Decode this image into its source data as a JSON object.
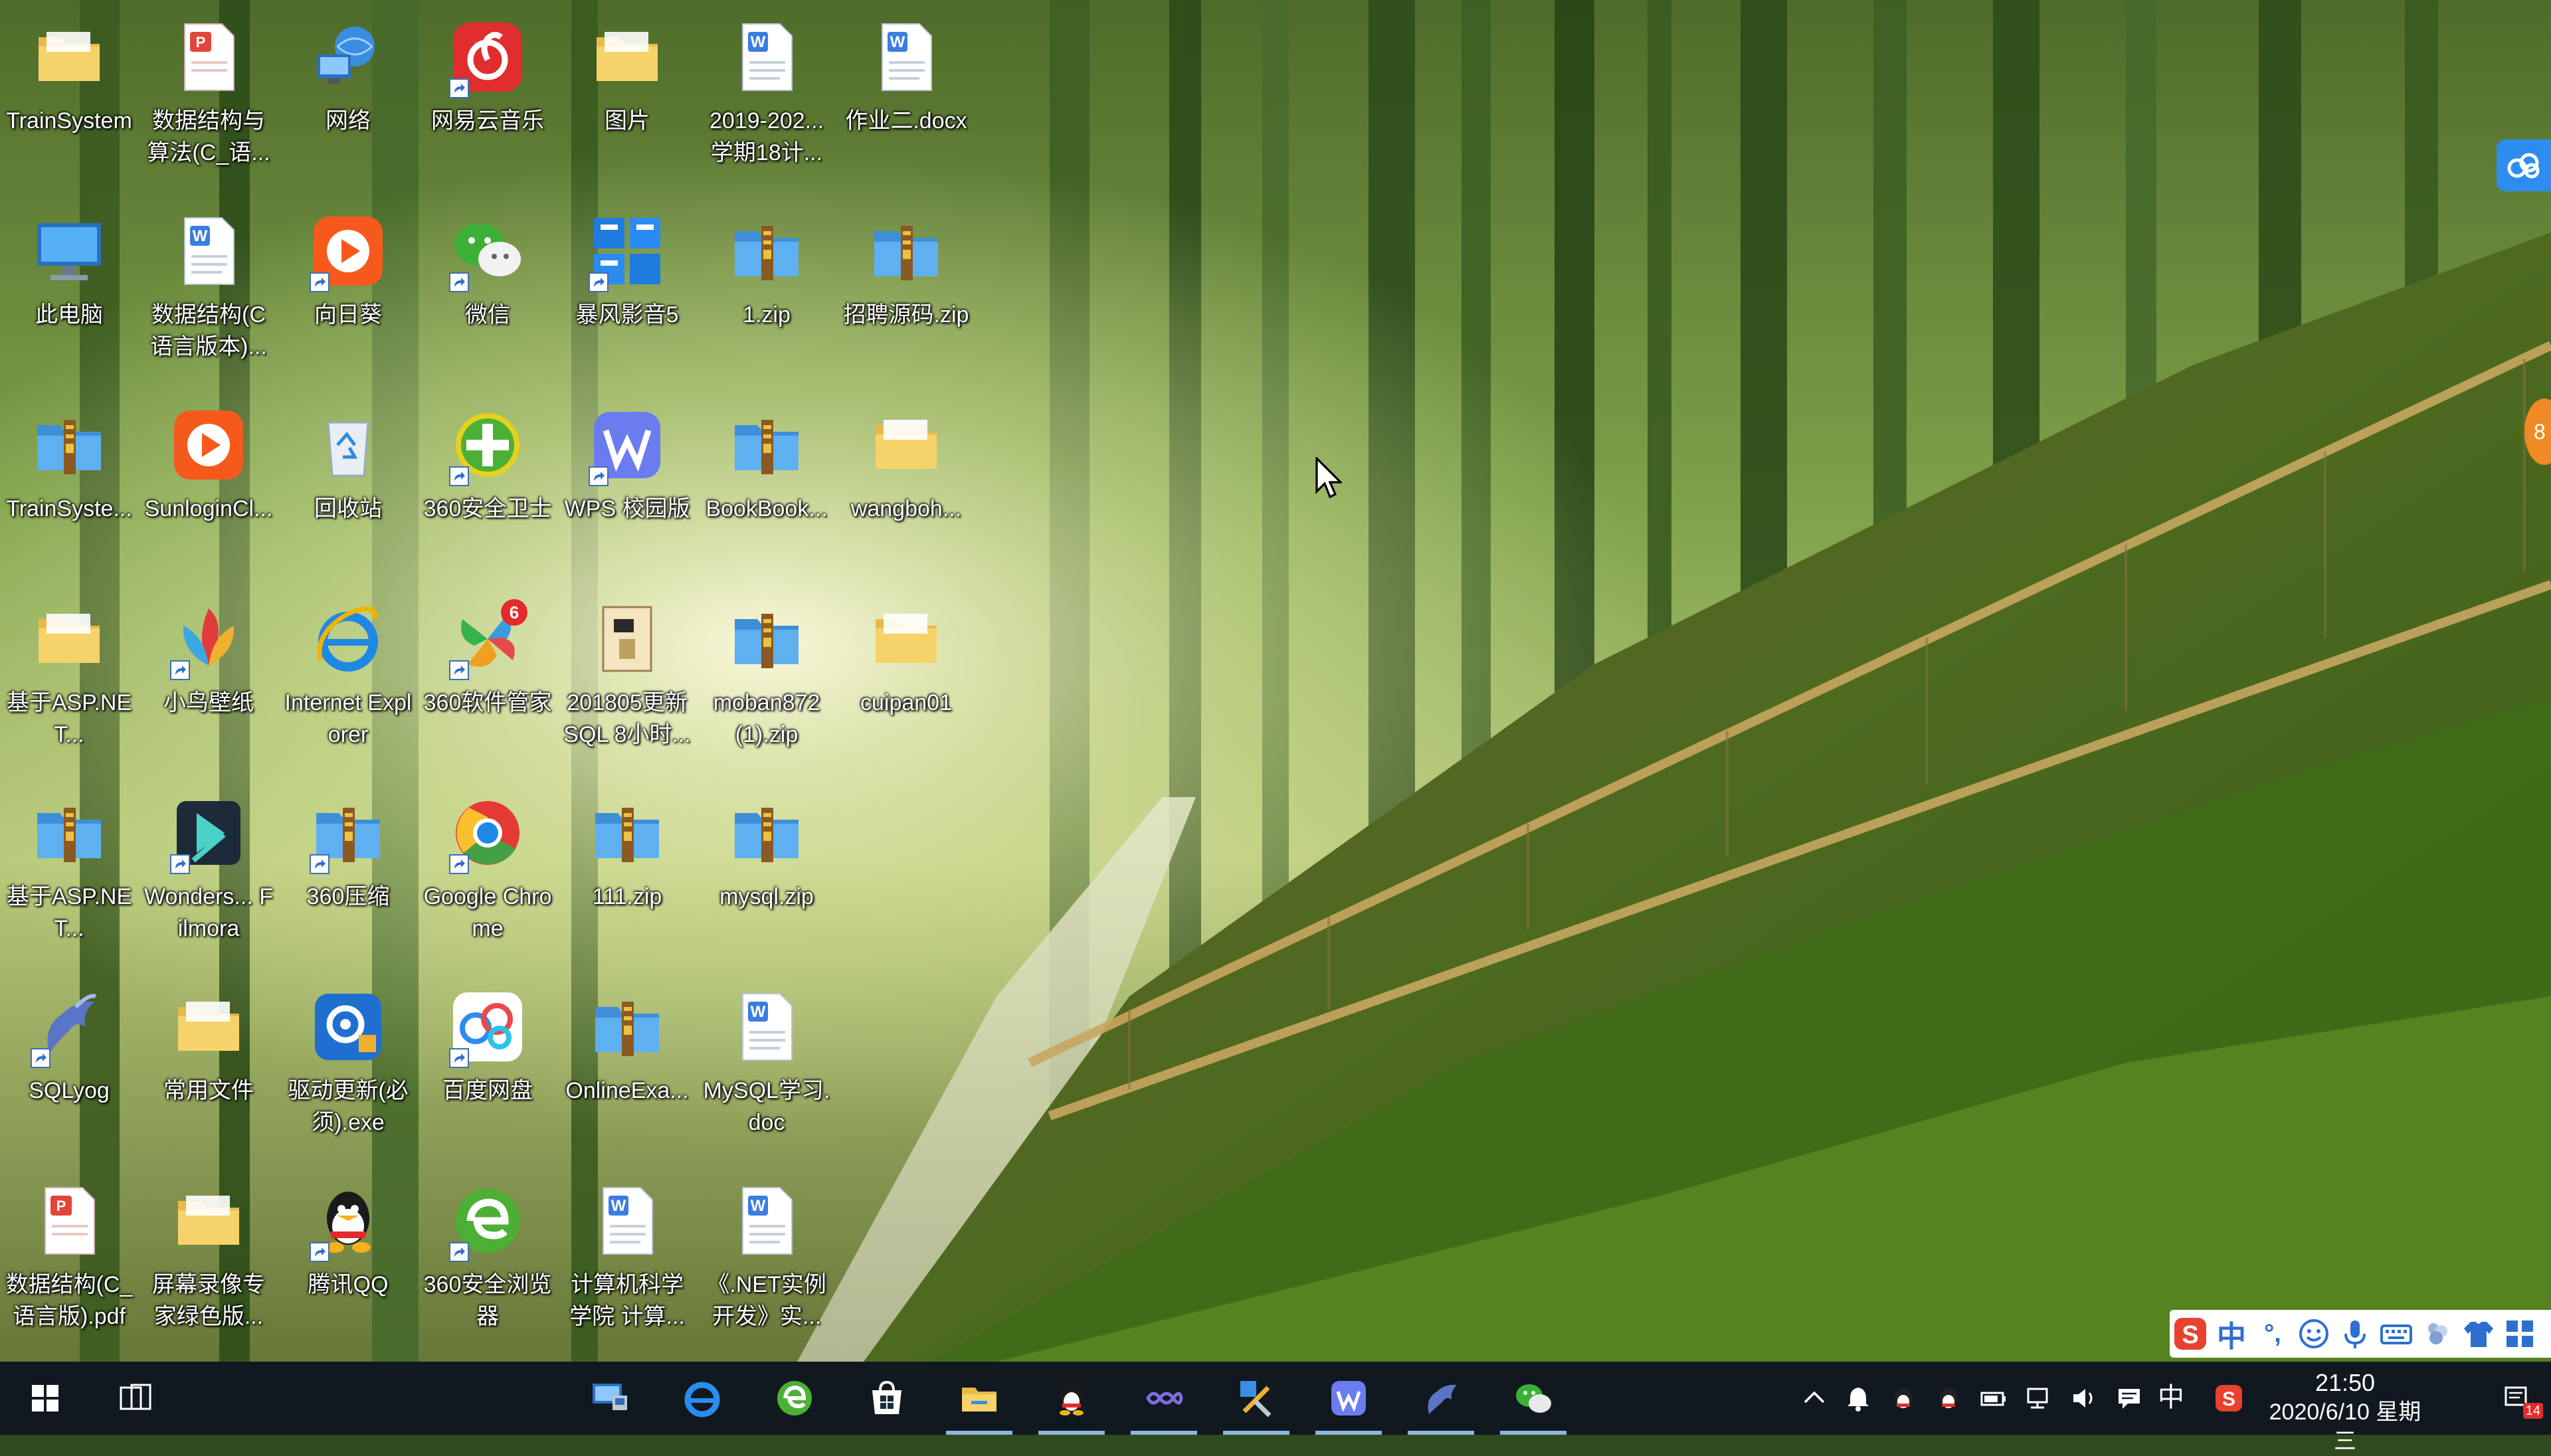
{
  "desktop": {
    "icons": [
      {
        "label": "TrainSystem",
        "icon": "folder-icon",
        "shortcut": false
      },
      {
        "label": "数据结构与算法(C_语...",
        "icon": "pdf-icon",
        "shortcut": false
      },
      {
        "label": "网络",
        "icon": "network-icon",
        "shortcut": false
      },
      {
        "label": "网易云音乐",
        "icon": "netease-music-icon",
        "shortcut": true
      },
      {
        "label": "图片",
        "icon": "folder-icon",
        "shortcut": false
      },
      {
        "label": "2019-202...学期18计...",
        "icon": "wps-doc-icon",
        "shortcut": false
      },
      {
        "label": "作业二.docx",
        "icon": "wps-doc-icon",
        "shortcut": false
      },
      {
        "label": "此电脑",
        "icon": "computer-icon",
        "shortcut": false
      },
      {
        "label": "数据结构(C语言版本)...",
        "icon": "wps-doc-icon",
        "shortcut": false
      },
      {
        "label": "向日葵",
        "icon": "sunlogin-icon",
        "shortcut": true
      },
      {
        "label": "微信",
        "icon": "wechat-icon",
        "shortcut": true
      },
      {
        "label": "暴风影音5",
        "icon": "baofeng-icon",
        "shortcut": true
      },
      {
        "label": "1.zip",
        "icon": "zip-icon",
        "shortcut": false
      },
      {
        "label": "招聘源码.zip",
        "icon": "zip-icon",
        "shortcut": false
      },
      {
        "label": "TrainSyste...",
        "icon": "zip-icon",
        "shortcut": false
      },
      {
        "label": "SunloginCl...",
        "icon": "sunlogin-icon",
        "shortcut": false
      },
      {
        "label": "回收站",
        "icon": "recycle-bin-icon",
        "shortcut": false
      },
      {
        "label": "360安全卫士",
        "icon": "360-security-icon",
        "shortcut": true
      },
      {
        "label": "WPS 校园版",
        "icon": "wps-icon",
        "shortcut": true
      },
      {
        "label": "BookBook...",
        "icon": "zip-icon",
        "shortcut": false
      },
      {
        "label": "wangboh...",
        "icon": "folder-icon",
        "shortcut": false
      },
      {
        "label": "基于ASP.NET...",
        "icon": "folder-icon",
        "shortcut": false
      },
      {
        "label": "小鸟壁纸",
        "icon": "bird-wallpaper-icon",
        "shortcut": true
      },
      {
        "label": "Internet Explorer",
        "icon": "ie-icon",
        "shortcut": false
      },
      {
        "label": "360软件管家",
        "icon": "360-software-icon",
        "shortcut": true,
        "badge": "6"
      },
      {
        "label": "201805更新SQL 8小时...",
        "icon": "archive-icon",
        "shortcut": false
      },
      {
        "label": "moban872(1).zip",
        "icon": "zip-icon",
        "shortcut": false
      },
      {
        "label": "cuipan01",
        "icon": "folder-icon",
        "shortcut": false
      },
      {
        "label": "基于ASP.NET...",
        "icon": "zip-icon",
        "shortcut": false
      },
      {
        "label": "Wonders... Filmora",
        "icon": "filmora-icon",
        "shortcut": true
      },
      {
        "label": "360压缩",
        "icon": "zip-icon",
        "shortcut": true
      },
      {
        "label": "Google Chrome",
        "icon": "chrome-icon",
        "shortcut": true
      },
      {
        "label": "111.zip",
        "icon": "zip-icon",
        "shortcut": false
      },
      {
        "label": "mysql.zip",
        "icon": "zip-icon",
        "shortcut": false
      },
      {
        "label": "SQLyog",
        "icon": "sqlyog-icon",
        "shortcut": true
      },
      {
        "label": "常用文件",
        "icon": "folder-icon",
        "shortcut": false
      },
      {
        "label": "驱动更新(必须).exe",
        "icon": "driver-update-icon",
        "shortcut": false
      },
      {
        "label": "百度网盘",
        "icon": "baidu-netdisk-icon",
        "shortcut": true
      },
      {
        "label": "OnlineExa...",
        "icon": "zip-icon",
        "shortcut": false
      },
      {
        "label": "MySQL学习.doc",
        "icon": "wps-doc-icon",
        "shortcut": false
      },
      {
        "label": "数据结构(C_语言版).pdf",
        "icon": "pdf-icon",
        "shortcut": false
      },
      {
        "label": "屏幕录像专家绿色版...",
        "icon": "folder-icon",
        "shortcut": false
      },
      {
        "label": "腾讯QQ",
        "icon": "qq-icon",
        "shortcut": true
      },
      {
        "label": "360安全浏览器",
        "icon": "360-browser-icon",
        "shortcut": true
      },
      {
        "label": "计算机科学学院 计算...",
        "icon": "wps-doc-icon",
        "shortcut": false
      },
      {
        "label": "《.NET实例开发》实...",
        "icon": "wps-doc-icon",
        "shortcut": false
      }
    ]
  },
  "taskbar": {
    "start_icon": "windows-start-icon",
    "task_view_icon": "task-view-icon",
    "pinned": [
      {
        "name": "remote-desktop-icon",
        "running": false
      },
      {
        "name": "edge-icon",
        "running": false
      },
      {
        "name": "360-browser-icon",
        "running": false
      },
      {
        "name": "store-icon",
        "running": false
      },
      {
        "name": "file-explorer-icon",
        "running": true
      },
      {
        "name": "qq-icon",
        "running": true
      },
      {
        "name": "vs-icon",
        "running": true
      },
      {
        "name": "tools-icon",
        "running": true
      },
      {
        "name": "wps-icon",
        "running": true
      },
      {
        "name": "sqlyog-icon",
        "running": true
      },
      {
        "name": "wechat-icon",
        "running": true
      }
    ],
    "tray": {
      "ime_char": "中",
      "time": "21:50",
      "date": "2020/6/10 星期三",
      "notification_count": "14"
    }
  },
  "ime_bar": {
    "mode": "中",
    "punct": "°,"
  },
  "side_widget_text": "8",
  "colors": {
    "taskbar": "#101820",
    "sogou": "#e8412d",
    "accent": "#2d6fd0"
  }
}
